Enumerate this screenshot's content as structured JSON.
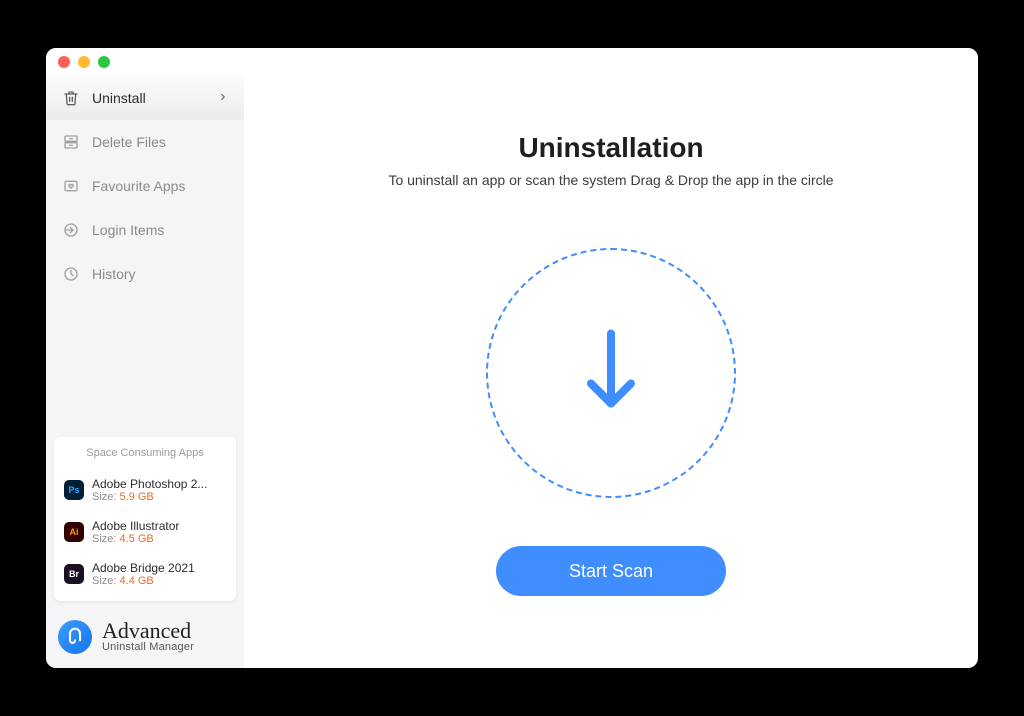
{
  "sidebar": {
    "items": [
      {
        "label": "Uninstall",
        "icon": "trash"
      },
      {
        "label": "Delete Files",
        "icon": "drawer"
      },
      {
        "label": "Favourite Apps",
        "icon": "heart-box"
      },
      {
        "label": "Login Items",
        "icon": "login"
      },
      {
        "label": "History",
        "icon": "clock"
      }
    ]
  },
  "spaceApps": {
    "title": "Space Consuming Apps",
    "sizeLabel": "Size:",
    "items": [
      {
        "name": "Adobe Photoshop 2...",
        "size": "5.9 GB",
        "badge": "Ps",
        "bg": "#001e36",
        "fg": "#31a8ff"
      },
      {
        "name": "Adobe Illustrator",
        "size": "4.5 GB",
        "badge": "Ai",
        "bg": "#330000",
        "fg": "#ff9a00"
      },
      {
        "name": "Adobe Bridge 2021",
        "size": "4.4 GB",
        "badge": "Br",
        "bg": "#1a0f24",
        "fg": "#ffffff"
      }
    ]
  },
  "brand": {
    "title": "Advanced",
    "subtitle": "Uninstall Manager"
  },
  "main": {
    "title": "Uninstallation",
    "subtitle": "To uninstall an app or scan the system Drag & Drop the app in the circle",
    "startScan": "Start Scan"
  }
}
